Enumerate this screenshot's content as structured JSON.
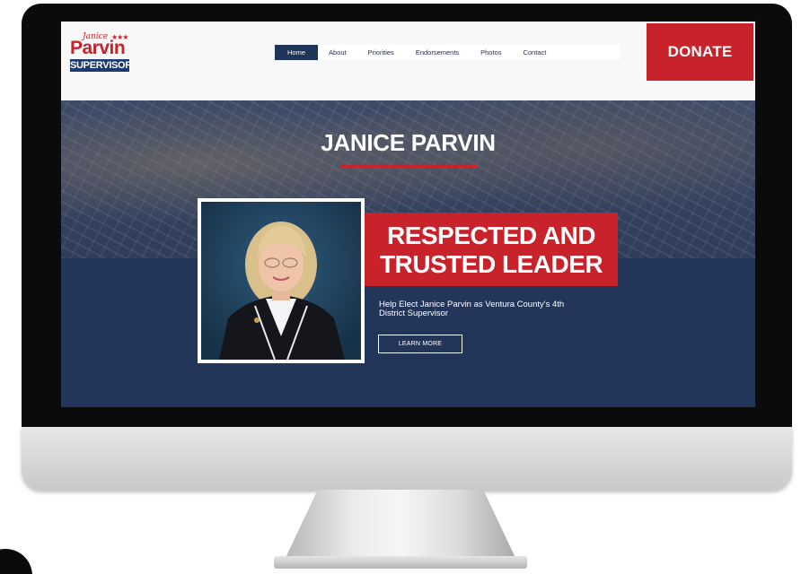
{
  "logo": {
    "script": "Janice",
    "stars": "★★★",
    "name": "Parvin",
    "office": "SUPERVISOR"
  },
  "nav": {
    "items": [
      {
        "label": "Home",
        "active": true
      },
      {
        "label": "About",
        "active": false
      },
      {
        "label": "Priorities",
        "active": false
      },
      {
        "label": "Endorsements",
        "active": false
      },
      {
        "label": "Photos",
        "active": false
      },
      {
        "label": "Contact",
        "active": false
      }
    ]
  },
  "donate": {
    "label": "DONATE"
  },
  "hero": {
    "title": "JANICE PARVIN",
    "headline_line1": "RESPECTED AND",
    "headline_line2": "TRUSTED LEADER",
    "subtext_line1": "Help Elect Janice Parvin as Ventura County's 4th",
    "subtext_line2": "District Supervisor",
    "cta": "LEARN MORE"
  },
  "colors": {
    "accent_red": "#c8222a",
    "navy": "#233659",
    "nav_active": "#1f3459"
  }
}
